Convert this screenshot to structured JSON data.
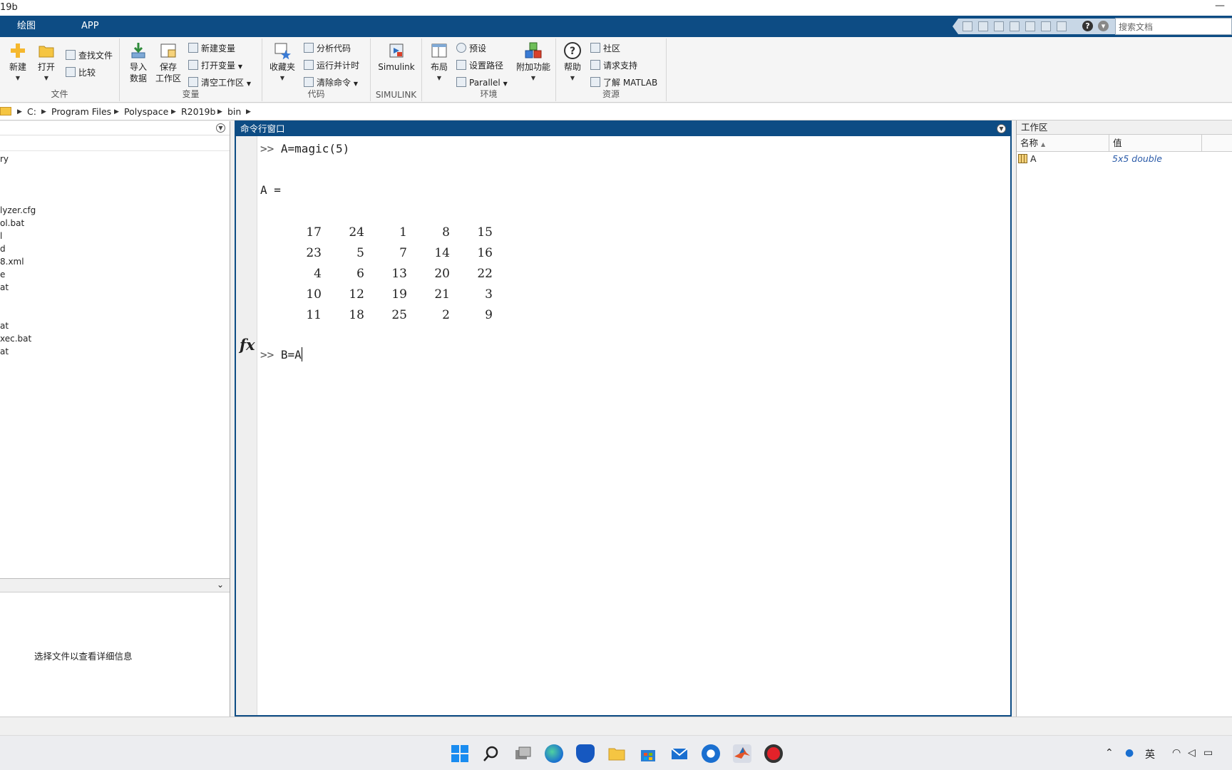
{
  "window": {
    "title": "19b",
    "minimize_glyph": "—"
  },
  "tabs": [
    {
      "label": "绘图"
    },
    {
      "label": "APP"
    }
  ],
  "search": {
    "placeholder": "搜索文档"
  },
  "ribbon": {
    "file": {
      "label": "文件",
      "new": "新建",
      "open": "打开",
      "find_files": "查找文件",
      "compare": "比较"
    },
    "variable": {
      "label": "变量",
      "import": [
        "导入",
        "数据"
      ],
      "save": [
        "保存",
        "工作区"
      ],
      "new_var": "新建变量",
      "open_var": "打开变量",
      "clear_ws": "清空工作区"
    },
    "code": {
      "label": "代码",
      "favorites": "收藏夹",
      "analyze": "分析代码",
      "run_time": "运行并计时",
      "clear_cmd": "清除命令"
    },
    "simulink": {
      "label": "SIMULINK",
      "simulink": "Simulink"
    },
    "env": {
      "label": "环境",
      "layout": "布局",
      "prefs": "预设",
      "set_path": "设置路径",
      "parallel": "Parallel",
      "addons": "附加功能"
    },
    "resources": {
      "label": "资源",
      "help": "帮助",
      "community": "社区",
      "support": "请求支持",
      "learn": "了解 MATLAB"
    }
  },
  "path": {
    "segments": [
      "C:",
      "Program Files",
      "Polyspace",
      "R2019b",
      "bin"
    ]
  },
  "file_browser": {
    "files": [
      "ry",
      "lyzer.cfg",
      "ol.bat",
      "l",
      "d",
      "8.xml",
      "e",
      "at",
      "at",
      "xec.bat",
      "at"
    ],
    "detail_message": "选择文件以查看详细信息"
  },
  "command_window": {
    "title": "命令行窗口",
    "prompt": ">>",
    "cmd1": "A=magic(5)",
    "output_label": "A =",
    "matrix": [
      [
        "17",
        "24",
        "1",
        "8",
        "15"
      ],
      [
        "23",
        "5",
        "7",
        "14",
        "16"
      ],
      [
        "4",
        "6",
        "13",
        "20",
        "22"
      ],
      [
        "10",
        "12",
        "19",
        "21",
        "3"
      ],
      [
        "11",
        "18",
        "25",
        "2",
        "9"
      ]
    ],
    "fx_label": "fx",
    "current_input": "B=A"
  },
  "workspace": {
    "title": "工作区",
    "col_name": "名称",
    "col_value": "值",
    "vars": [
      {
        "name": "A",
        "value": "5x5 double"
      }
    ]
  },
  "taskbar": {
    "ime": "英"
  },
  "colors": {
    "accent": "#0d4c84"
  }
}
